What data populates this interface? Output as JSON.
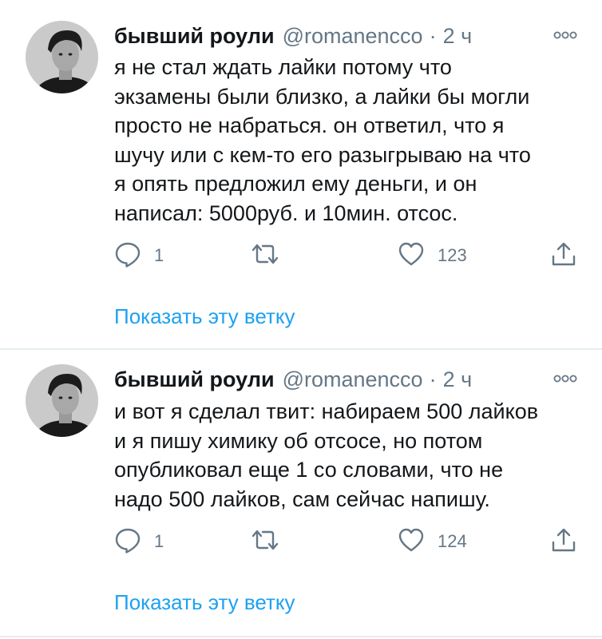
{
  "tweets": [
    {
      "display_name": "бывший роули",
      "handle": "@romanencco",
      "separator": "·",
      "time": "2 ч",
      "text": "я не стал ждать лайки потому что\nэкзамены были близко, а лайки бы могли\nпросто не набраться. он ответил, что я\nшучу или с кем-то его разыгрываю на что\nя опять предложил ему деньги, и он\nнаписал: 5000руб. и 10мин. отсос.",
      "reply_count": "1",
      "retweet_count": "",
      "like_count": "123",
      "show_thread": "Показать эту ветку"
    },
    {
      "display_name": "бывший роули",
      "handle": "@romanencco",
      "separator": "·",
      "time": "2 ч",
      "text": "и вот я сделал твит: набираем 500 лайков\nи я пишу химику об отсосе, но потом\nопубликовал еще 1 со словами, что не\nнадо 500 лайков, сам сейчас напишу.",
      "reply_count": "1",
      "retweet_count": "",
      "like_count": "124",
      "show_thread": "Показать эту ветку"
    }
  ],
  "icons": {
    "reply": "reply-icon",
    "retweet": "retweet-icon",
    "like": "heart-icon",
    "share": "share-icon",
    "more": "more-options-icon"
  },
  "colors": {
    "text": "#14171a",
    "secondary": "#657786",
    "link": "#1da1f2",
    "divider": "#e6ecf0"
  }
}
